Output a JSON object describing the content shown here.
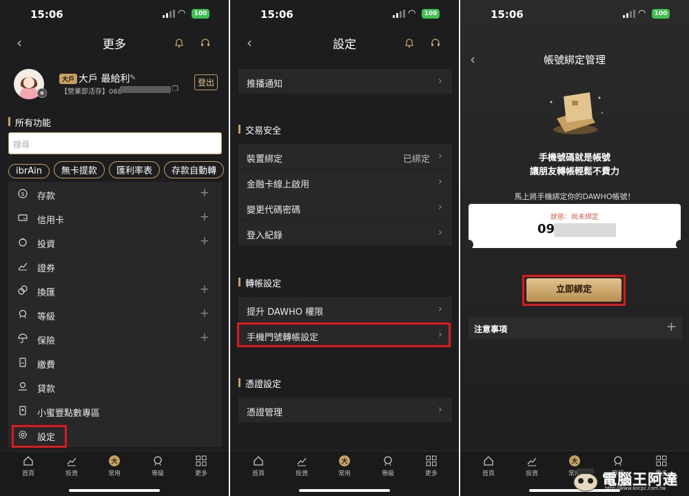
{
  "status": {
    "time": "15:06",
    "battery": "100"
  },
  "panel1": {
    "title": "更多",
    "user": {
      "level_badge": "大戶",
      "name": "大戶 最給利",
      "account": "【營業部活存】068",
      "logout": "登出"
    },
    "section_title": "所有功能",
    "search_placeholder": "搜尋",
    "chips": [
      "ibrAin",
      "無卡提款",
      "匯利率表",
      "存款自動轉"
    ],
    "menu": [
      {
        "label": "存款",
        "plus": "+"
      },
      {
        "label": "信用卡",
        "plus": "+"
      },
      {
        "label": "投資",
        "plus": "+"
      },
      {
        "label": "證券",
        "plus": ""
      },
      {
        "label": "換匯",
        "plus": "+"
      },
      {
        "label": "等級",
        "plus": "+"
      },
      {
        "label": "保險",
        "plus": "+"
      },
      {
        "label": "繳費",
        "plus": ""
      },
      {
        "label": "貸款",
        "plus": ""
      },
      {
        "label": "小蜜豐點數專區",
        "plus": ""
      },
      {
        "label": "設定",
        "plus": ""
      }
    ]
  },
  "panel2": {
    "title": "設定",
    "push": "推播通知",
    "sec_security": "交易安全",
    "security": [
      {
        "label": "裝置綁定",
        "value": "已綁定"
      },
      {
        "label": "金融卡線上啟用",
        "value": ""
      },
      {
        "label": "變更代碼密碼",
        "value": ""
      },
      {
        "label": "登入紀錄",
        "value": ""
      }
    ],
    "sec_transfer": "轉帳設定",
    "transfer": [
      {
        "label": "提升 DAWHO 權限"
      },
      {
        "label": "手機門號轉帳設定"
      }
    ],
    "sec_cert": "憑證設定",
    "cert": [
      {
        "label": "憑證管理"
      }
    ]
  },
  "panel3": {
    "title": "帳號綁定管理",
    "tagline1": "手機號碼就是帳號",
    "tagline2": "讓朋友轉帳輕鬆不費力",
    "hint": "馬上將手機綁定你的DAWHO帳號！",
    "status_label": "狀態：尚未綁定",
    "phone_prefix": "09",
    "bind_button": "立即綁定",
    "notice": "注意事項"
  },
  "tabs": [
    "首頁",
    "投資",
    "常用",
    "等級",
    "更多"
  ],
  "watermark": {
    "text": "電腦王阿達",
    "url": "http://www.kocpc.com.tw"
  },
  "colors": {
    "gold": "#c7a164",
    "highlight": "#e01a1a",
    "bg": "#1d1d1f"
  }
}
